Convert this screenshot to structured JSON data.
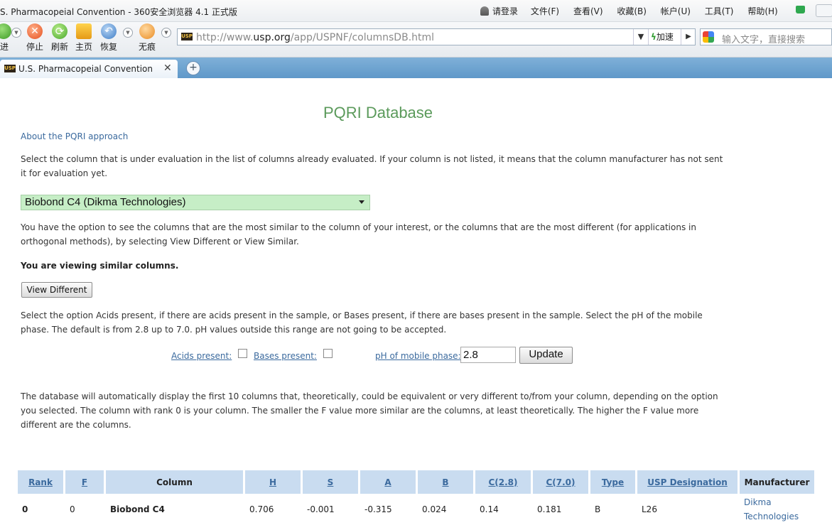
{
  "window": {
    "title": "S. Pharmacopeial Convention - 360安全浏览器 4.1 正式版",
    "login": "请登录",
    "menus": [
      "文件(F)",
      "查看(V)",
      "收藏(B)",
      "帐户(U)",
      "工具(T)",
      "帮助(H)"
    ]
  },
  "toolbar": {
    "forward": "进",
    "stop": "停止",
    "refresh": "刷新",
    "home": "主页",
    "restore": "恢复",
    "incognito": "无痕"
  },
  "address": {
    "url_prefix": "http://www.",
    "url_domain": "usp.org",
    "url_path": "/app/USPNF/columnsDB.html",
    "accelerate": "加速"
  },
  "search": {
    "placeholder": "输入文字，直接搜索"
  },
  "tab": {
    "title": "U.S. Pharmacopeial Convention",
    "favicon": "USP"
  },
  "page": {
    "heading": "PQRI Database",
    "about_link": "About the PQRI approach",
    "intro": "Select the column that is under evaluation in the list of columns already evaluated. If your column is not listed, it means that the column manufacturer has not sent it for evaluation yet.",
    "selected_column": "Biobond C4 (Dikma Technologies)",
    "option_text": "You have the option to see the columns that are the most similar to the column of your interest, or the columns that are the most different (for applications in orthogonal methods), by selecting View Different or View Similar.",
    "viewing": "You are viewing similar columns.",
    "view_button": "View Different",
    "acids_text": "Select the option Acids present, if there are acids present in the sample, or Bases present, if there are bases present in the sample. Select the pH of the mobile phase. The default is from 2.8 up to 7.0. pH values outside this range are not going to be accepted.",
    "acids_label": "Acids present:",
    "bases_label": "Bases present:",
    "ph_label": "pH of mobile phase:",
    "ph_value": "2.8",
    "update_button": "Update",
    "display_text": "The database will automatically display the first 10 columns that, theoretically, could be equivalent or very different to/from your column, depending on the option you selected. The column with rank 0 is your column. The smaller the F value more similar are the columns, at least theoretically. The higher the F value more different are the columns."
  },
  "table": {
    "headers": [
      "Rank",
      "F",
      "Column",
      "H",
      "S",
      "A",
      "B",
      "C(2.8)",
      "C(7.0)",
      "Type",
      "USP Designation",
      "Manufacturer"
    ],
    "rows": [
      [
        "0",
        "0",
        "Biobond C4",
        "0.706",
        "-0.001",
        "-0.315",
        "0.024",
        "0.14",
        "0.181",
        "B",
        "L26",
        "Dikma Technologies"
      ]
    ]
  }
}
